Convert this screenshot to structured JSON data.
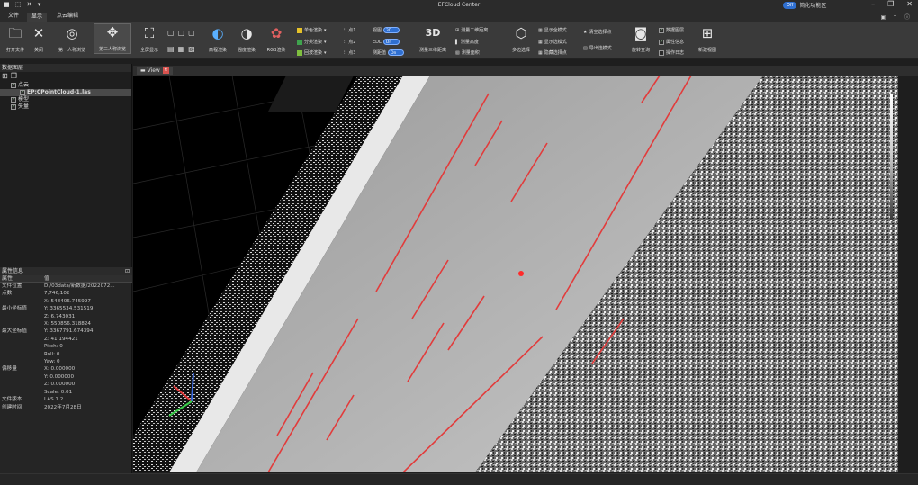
{
  "titlebar": {
    "quick_access": "■ ⬚ ✕ ▾",
    "title": "EFCloud Center",
    "toggle_state": "Off",
    "toggle_label": "简化功能区"
  },
  "menubar": {
    "tabs": [
      "文件",
      "显示",
      "点云编辑"
    ],
    "active_tab": "显示",
    "right_icons": "▣ ⌃ ⓘ"
  },
  "ribbon": {
    "open_file": "打开文件",
    "close": "关闭",
    "first_person": "第一人称浏览",
    "third_person": "第三人称浏览",
    "full_screen": "全屏显示",
    "elevation_render": "高程渲染",
    "intensity_render": "强度渲染",
    "rgb_render": "RGB渲染",
    "single_color": "单色渲染",
    "class_render": "分类渲染",
    "return_render": "回波渲染",
    "point1": "点1",
    "point2": "点2",
    "point3": "点3",
    "view_label": "视图",
    "view_value": "3D",
    "edl_label": "EDL",
    "edl_value": "On",
    "eye_dome": "测距值",
    "eye_dome_value": "On",
    "measure_3d": "测量三维距离",
    "measure_2d": "测量二维距离",
    "measure_height": "测量高度",
    "measure_area": "测量面积",
    "select_mode": "多边选择",
    "show_full": "显示全模式",
    "show_select": "显示选模式",
    "hide_select": "隐藏选择点",
    "clear_select": "清空选择点",
    "export_select": "导出选模式",
    "fly_mode": "旋转查询",
    "data_layers": "数据图层",
    "attribute_info": "属性信息",
    "operation_log": "操作日志",
    "new_view": "新建视图"
  },
  "layers_panel": {
    "title": "数据图层",
    "items": [
      {
        "label": "点云",
        "level": 0,
        "checked": true
      },
      {
        "label": "EP:CPointCloud-1.las",
        "level": 1,
        "checked": true,
        "selected": true
      },
      {
        "label": "模型",
        "level": 0,
        "checked": true
      },
      {
        "label": "矢量",
        "level": 0,
        "checked": true
      }
    ]
  },
  "properties_panel": {
    "title": "属性信息",
    "header": {
      "key": "属性",
      "value": "值"
    },
    "rows": [
      {
        "k": "文件位置",
        "v": "D:/03data/新数据/2022072..."
      },
      {
        "k": "点数",
        "v": "7,746,102"
      },
      {
        "k": "",
        "v": "X: 548406.745997"
      },
      {
        "k": "最小坐标值",
        "v": "Y: 3365534.531519"
      },
      {
        "k": "",
        "v": "Z: 6.743031"
      },
      {
        "k": "",
        "v": "X: 550856.318824"
      },
      {
        "k": "最大坐标值",
        "v": "Y: 3367791.674394"
      },
      {
        "k": "",
        "v": "Z: 41.194421"
      },
      {
        "k": "",
        "v": "Pitch: 0"
      },
      {
        "k": "",
        "v": "Roll: 0"
      },
      {
        "k": "",
        "v": "Yaw: 0"
      },
      {
        "k": "偏移量",
        "v": "X: 0.000000"
      },
      {
        "k": "",
        "v": "Y: 0.000000"
      },
      {
        "k": "",
        "v": "Z: 0.000000"
      },
      {
        "k": "",
        "v": "Scale: 0.01"
      },
      {
        "k": "文件版本",
        "v": "LAS 1.2"
      },
      {
        "k": "创建时间",
        "v": "2022年7月28日"
      }
    ]
  },
  "viewport": {
    "tab_label": "View",
    "accent_color": "#e23b3b"
  },
  "colors": {
    "toggle_on": "#2f6fd0",
    "road_mark": "#e23b3b",
    "selected_point": "#ff2a2a"
  }
}
